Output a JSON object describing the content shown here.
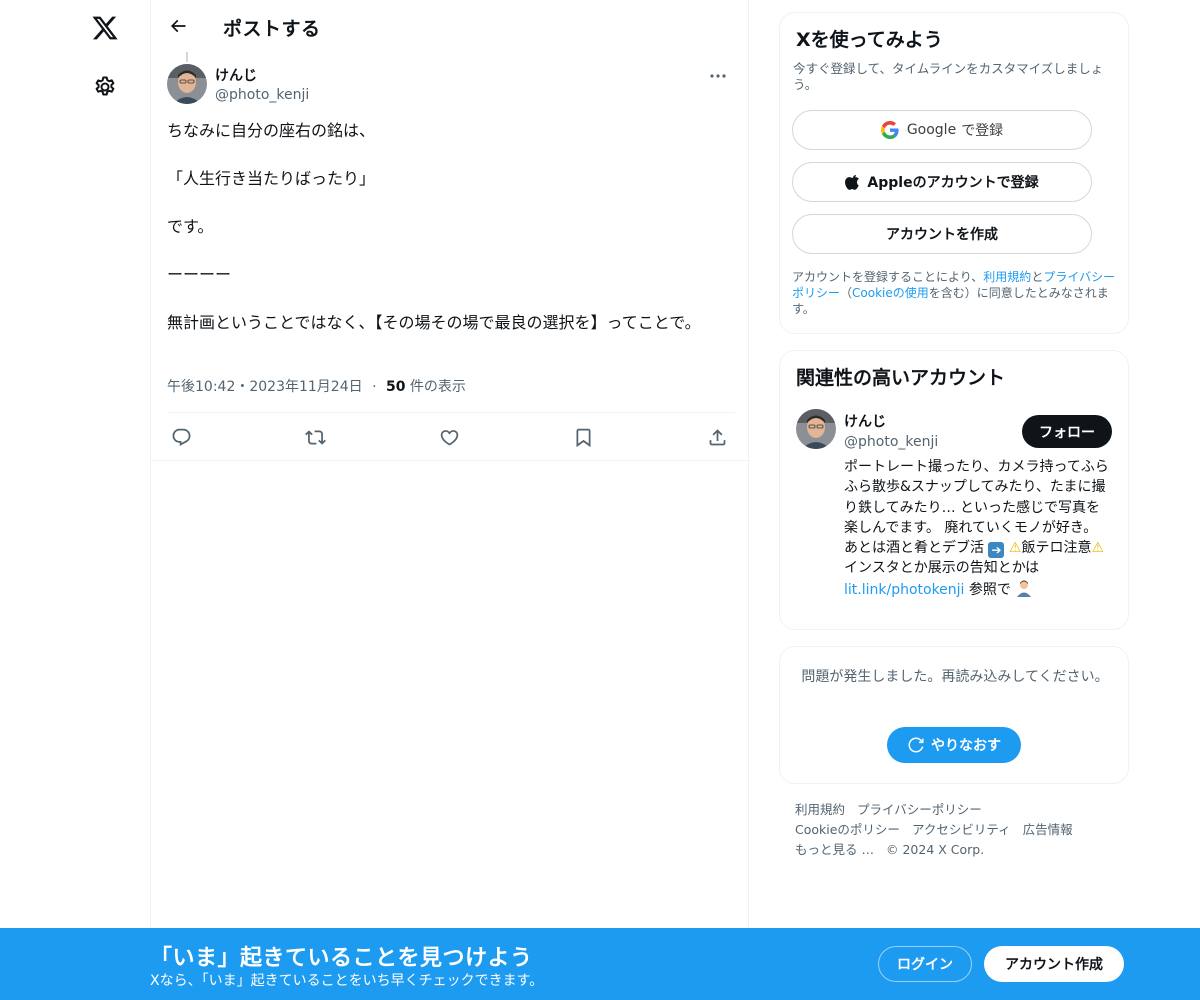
{
  "nav": {
    "logo_icon": "x-logo-icon",
    "settings_icon": "gear-icon"
  },
  "header": {
    "title": "ポストする"
  },
  "post": {
    "author_name": "けんじ",
    "author_handle": "@photo_kenji",
    "text_paragraphs": [
      "ちなみに自分の座右の銘は、",
      "「人生行き当たりばったり」",
      "です。",
      "ーーーー",
      "無計画ということではなく、【その場その場で最良の選択を】ってことで。"
    ],
    "timestamp": "午後10:42・2023年11月24日",
    "separator": "·",
    "view_count": "50",
    "view_label": "件の表示"
  },
  "signup": {
    "title": "Xを使ってみよう",
    "subtitle": "今すぐ登録して、タイムラインをカスタマイズしましょう。",
    "google_brand": "Google",
    "google_suffix": "で登録",
    "apple_label": "Appleのアカウントで登録",
    "create_label": "アカウントを作成",
    "legal_prefix": "アカウントを登録することにより、",
    "terms_link": "利用規約",
    "legal_and": "と",
    "privacy_link": "プライバシーポリシー",
    "legal_paren_open": "（",
    "cookie_link": "Cookieの使用",
    "legal_suffix": "を含む）に同意したとみなされます。"
  },
  "recommend": {
    "title": "関連性の高いアカウント",
    "name": "けんじ",
    "handle": "@photo_kenji",
    "follow_label": "フォロー",
    "bio_main": "ポートレート撮ったり、カメラ持ってふらふら散歩&スナップしてみたり、たまに撮り鉄してみたり… といった感じで写真を楽しんでます。 廃れていくモノが好き。 あとは酒と肴とデブ活",
    "bio_warn": "飯テロ注意",
    "bio_mid": "インスタとか展示の告知とかは",
    "bio_link": "lit.link/photokenji",
    "bio_end": "参照で"
  },
  "error_card": {
    "message": "問題が発生しました。再読み込みしてください。",
    "retry_label": "やりなおす"
  },
  "footer": {
    "links": [
      "利用規約",
      "プライバシーポリシー",
      "Cookieのポリシー",
      "アクセシビリティ",
      "広告情報",
      "もっと見る …",
      "© 2024 X Corp."
    ]
  },
  "banner": {
    "title": "「いま」起きていることを見つけよう",
    "subtitle": "Xなら、「いま」起きていることをいち早くチェックできます。",
    "login_label": "ログイン",
    "create_label": "アカウント作成"
  },
  "colors": {
    "accent": "#1d9bf0",
    "text": "#0f1419",
    "muted": "#536471",
    "border": "#eff3f4"
  }
}
